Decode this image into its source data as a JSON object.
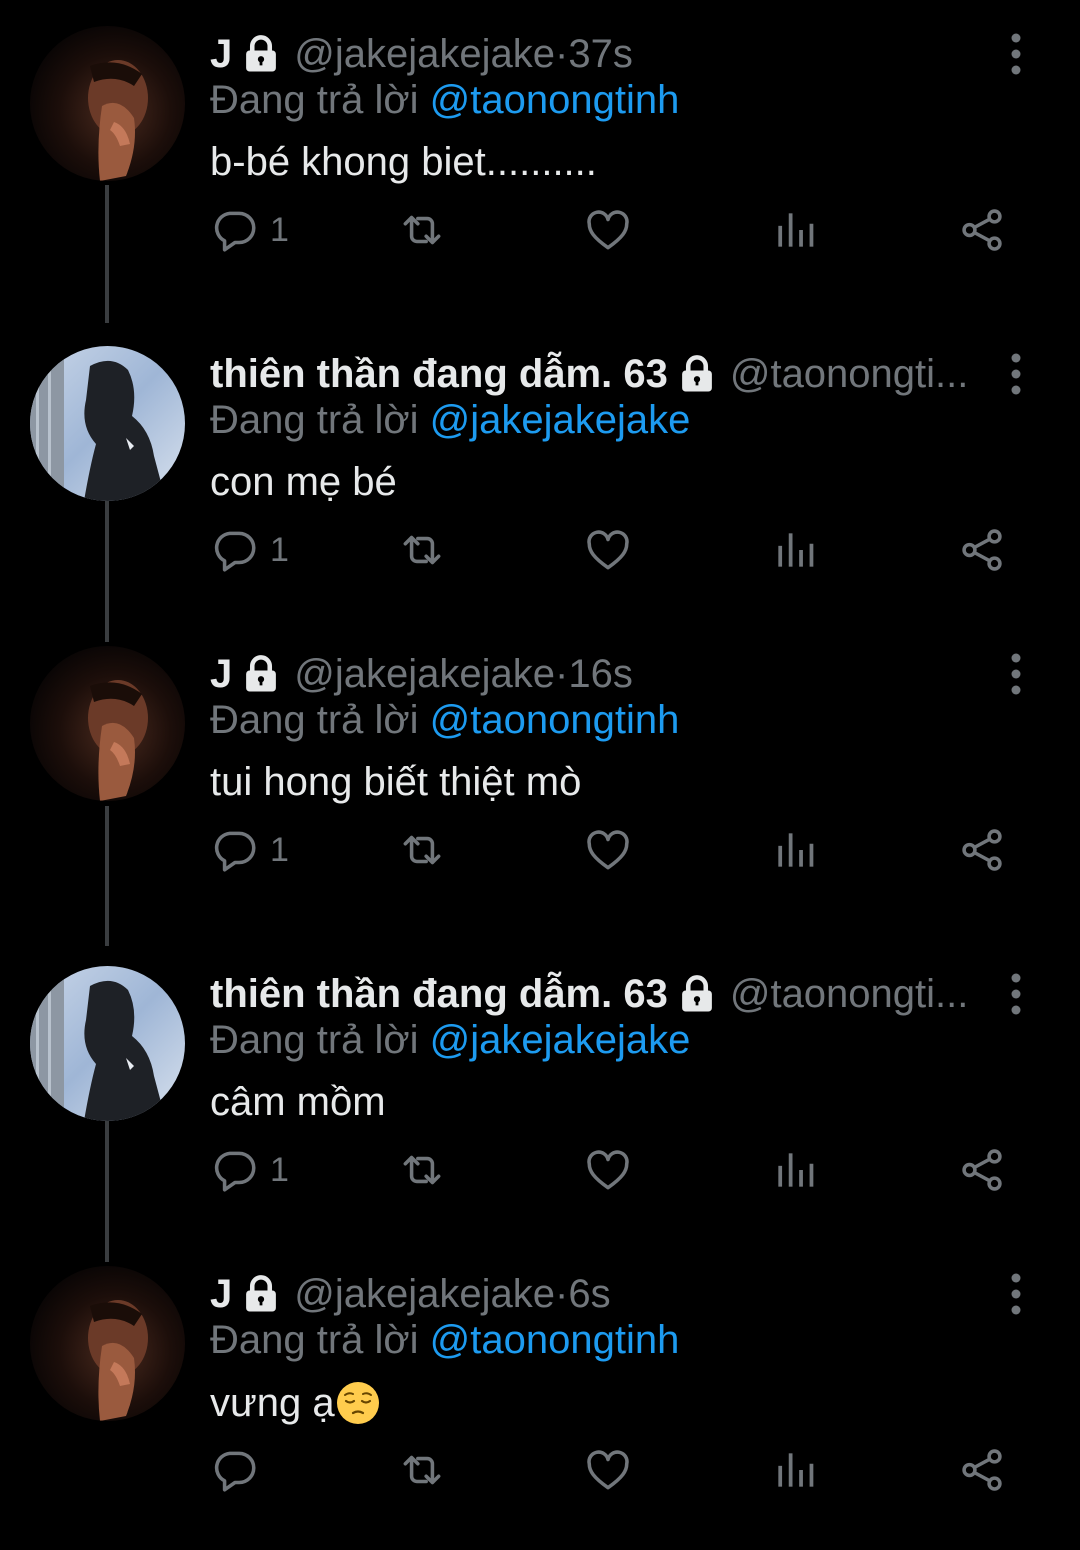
{
  "colors": {
    "background": "#000000",
    "primary_text": "#e7e9ea",
    "secondary_text": "#71767b",
    "link": "#1d9bf0",
    "thread_line": "#3a3d40"
  },
  "icons": {
    "lock": "lock-icon",
    "more": "more-vertical-icon",
    "reply": "reply-bubble-icon",
    "retweet": "retweet-icon",
    "like": "heart-icon",
    "views": "analytics-bars-icon",
    "share": "share-icon",
    "emoji": "pensive-face-emoji"
  },
  "tweets": [
    {
      "author": "jake",
      "name": "J",
      "handle": "@jakejakejake",
      "time_sep": " · ",
      "time": "37s",
      "reply_prefix": "Đang trả lời ",
      "reply_to": "@taonongtinh",
      "text": "b-bé khong biet..........",
      "reply_count": "1"
    },
    {
      "author": "taonongtinh",
      "name": "thiên thần đang dẫm. 63",
      "handle": "@taonongti...",
      "time_sep": "",
      "time": "",
      "reply_prefix": "Đang trả lời ",
      "reply_to": "@jakejakejake",
      "text": "con mẹ bé",
      "reply_count": "1"
    },
    {
      "author": "jake",
      "name": "J",
      "handle": "@jakejakejake",
      "time_sep": " · ",
      "time": "16s",
      "reply_prefix": "Đang trả lời ",
      "reply_to": "@taonongtinh",
      "text": "tui hong biết thiệt mò",
      "reply_count": "1"
    },
    {
      "author": "taonongtinh",
      "name": "thiên thần đang dẫm. 63",
      "handle": "@taonongti...",
      "time_sep": "",
      "time": "",
      "reply_prefix": "Đang trả lời ",
      "reply_to": "@jakejakejake",
      "text": "câm mồm",
      "reply_count": "1"
    },
    {
      "author": "jake",
      "name": "J",
      "handle": "@jakejakejake",
      "time_sep": " · ",
      "time": "6s",
      "reply_prefix": "Đang trả lời ",
      "reply_to": "@taonongtinh",
      "text": "vưng ạ",
      "reply_count": ""
    }
  ]
}
